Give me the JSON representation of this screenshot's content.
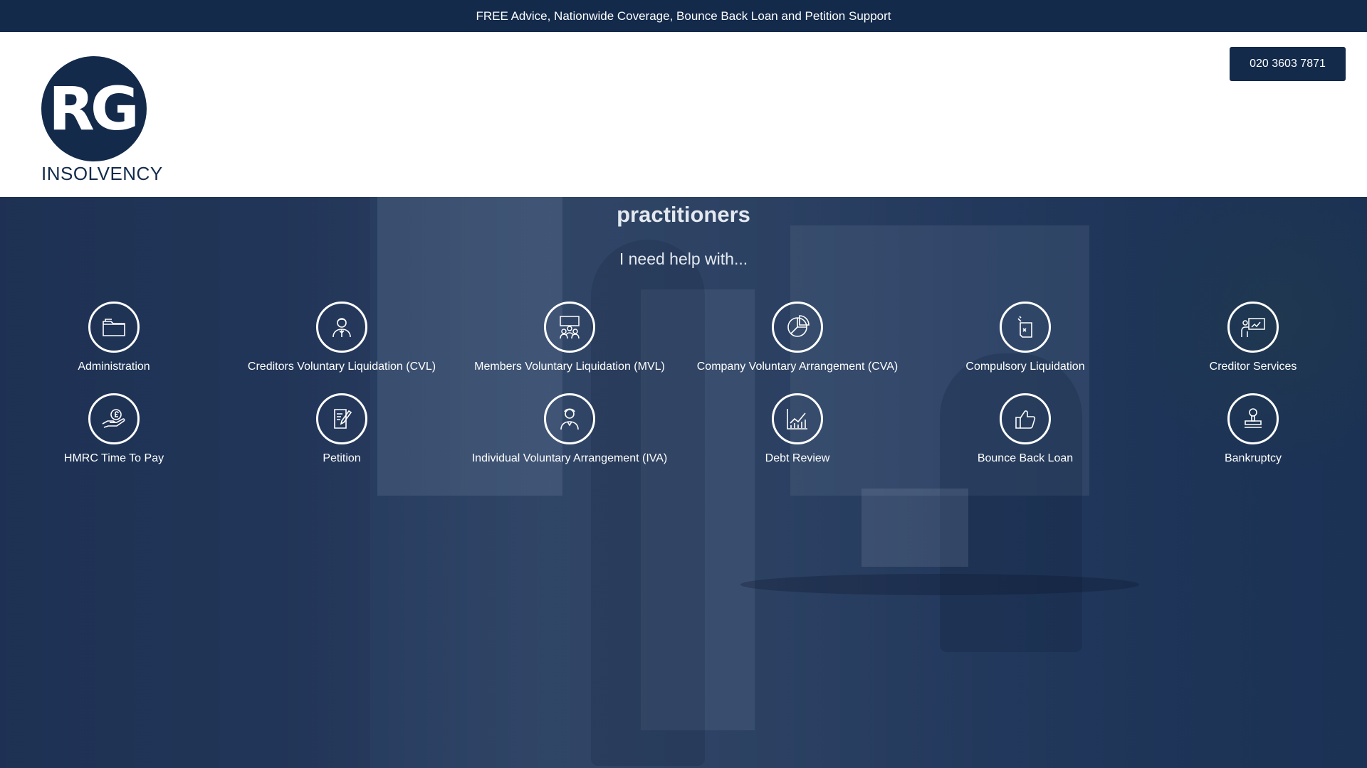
{
  "topbar": {
    "text": "FREE Advice, Nationwide Coverage, Bounce Back Loan and Petition Support"
  },
  "header": {
    "logo_initials": "RG",
    "logo_word": "INSOLVENCY",
    "phone_label": "020 3603 7871"
  },
  "hero": {
    "heading": "RG Insolvency are leading licensed insolvency practitioners",
    "subheading": "I need help with..."
  },
  "services": [
    {
      "label": "Administration",
      "icon": "folder-icon"
    },
    {
      "label": "Creditors Voluntary Liquidation (CVL)",
      "icon": "businessman-icon"
    },
    {
      "label": "Members Voluntary Liquidation (MVL)",
      "icon": "team-meeting-icon"
    },
    {
      "label": "Company Voluntary Arrangement (CVA)",
      "icon": "pie-chart-icon"
    },
    {
      "label": "Compulsory Liquidation",
      "icon": "document-stamp-icon"
    },
    {
      "label": "Creditor Services",
      "icon": "presentation-icon"
    },
    {
      "label": "HMRC Time To Pay",
      "icon": "hand-coin-icon"
    },
    {
      "label": "Petition",
      "icon": "document-pen-icon"
    },
    {
      "label": "Individual Voluntary Arrangement (IVA)",
      "icon": "person-icon"
    },
    {
      "label": "Debt Review",
      "icon": "line-chart-icon"
    },
    {
      "label": "Bounce Back Loan",
      "icon": "thumbs-up-icon"
    },
    {
      "label": "Bankruptcy",
      "icon": "stamp-icon"
    }
  ],
  "colors": {
    "navy": "#132a4b",
    "overlay": "#1d3458",
    "white": "#ffffff"
  }
}
